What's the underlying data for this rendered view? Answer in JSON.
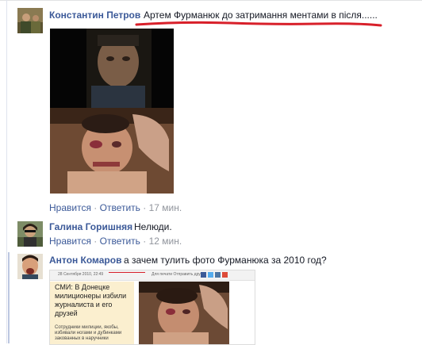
{
  "comments": [
    {
      "author": "Константин Петров",
      "text": "Артем Фурманюк до затримання ментами в після......",
      "actions": {
        "like": "Нравится",
        "reply": "Ответить",
        "sep": "·",
        "time": "17 мин."
      }
    },
    {
      "author": "Галина Горишняя",
      "text": "Нелюди.",
      "actions": {
        "like": "Нравится",
        "reply": "Ответить",
        "sep": "·",
        "time": "12 мин."
      }
    },
    {
      "author": "Антон Комаров",
      "text": "а зачем тулить фото Фурманюка за 2010 год?",
      "preview": {
        "headline": "СМИ: В Донецке милиционеры избили журналиста и его друзей",
        "lead": "Сотрудники милиции, якобы, избивали ногами и дубинками закованных в наручники",
        "date": "28 Сентября 2010, 22:49",
        "toolbar_text": "Для печати  Отправить другу"
      }
    }
  ],
  "colors": {
    "link": "#3b5998",
    "text": "#141823",
    "meta": "#90949c",
    "underline": "#d8202a"
  }
}
